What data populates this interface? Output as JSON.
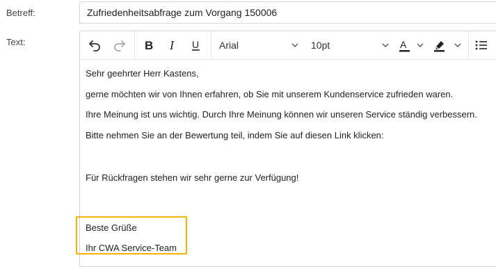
{
  "form": {
    "subject_label": "Betreff:",
    "subject_value": "Zufriedenheitsabfrage zum Vorgang 150006",
    "text_label": "Text:"
  },
  "toolbar": {
    "font_family": "Arial",
    "font_size": "10pt",
    "icons": [
      "undo-icon",
      "redo-icon",
      "bold-icon",
      "italic-icon",
      "underline-icon",
      "font-color-icon",
      "highlight-icon",
      "bullet-list-icon"
    ],
    "accent_color": "#f5b400"
  },
  "body": {
    "lines": [
      "Sehr geehrter Herr Kastens,",
      "gerne möchten wir von Ihnen erfahren, ob Sie mit unserem Kundenservice zufrieden waren.",
      "Ihre Meinung ist uns wichtig. Durch Ihre Meinung können wir unseren Service ständig verbessern.",
      "Bitte nehmen Sie an der Bewertung teil, indem Sie auf diesen Link klicken:",
      "Für Rückfragen stehen wir sehr gerne zur Verfügung!",
      "Beste Grüße",
      "Ihr CWA Service-Team"
    ]
  }
}
